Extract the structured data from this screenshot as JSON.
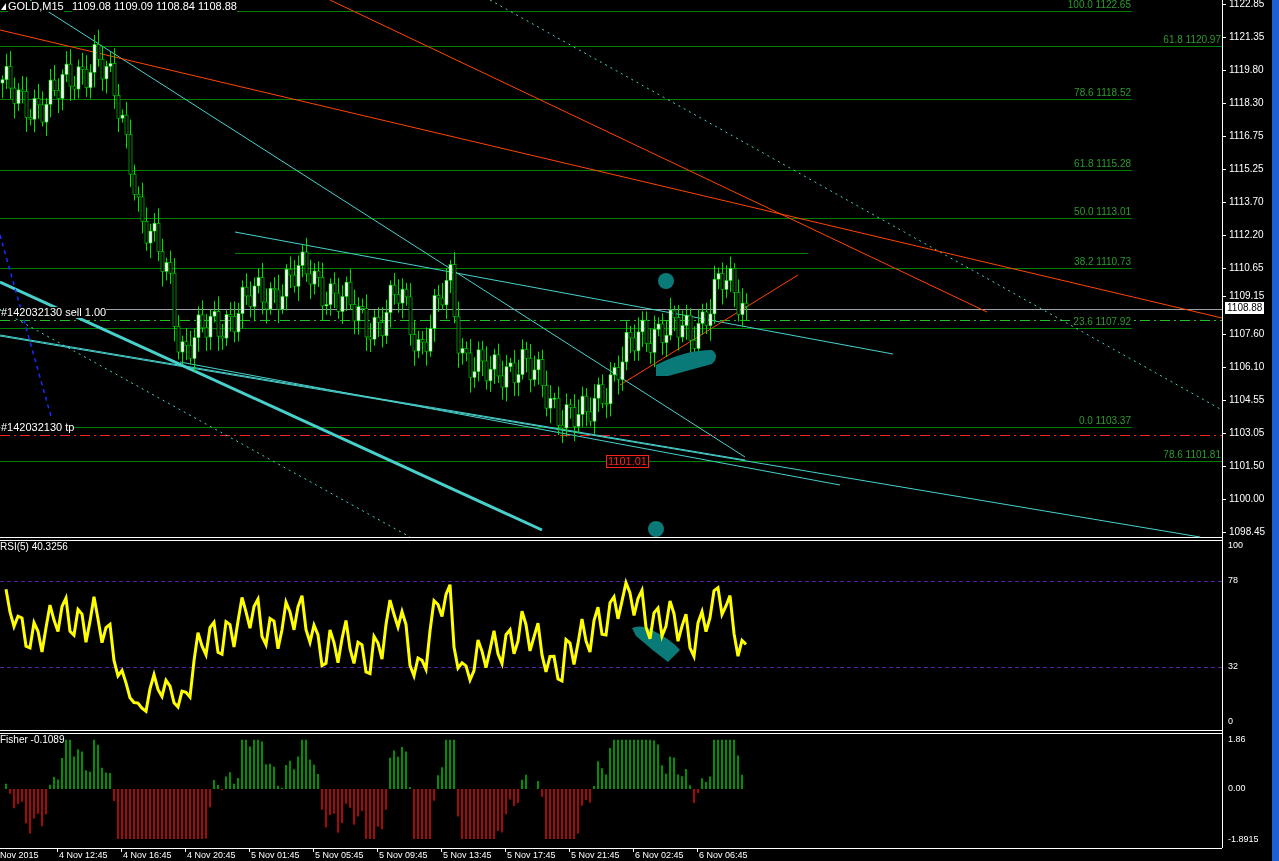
{
  "symbol": {
    "title": "GOLD,M15",
    "ohlc": "1109.08 1109.09 1108.84 1108.88"
  },
  "price_axis": {
    "labels": [
      "1122.85",
      "1121.35",
      "1119.80",
      "1118.30",
      "1116.75",
      "1115.25",
      "1113.70",
      "1112.20",
      "1110.65",
      "1109.15",
      "1107.60",
      "1106.10",
      "1104.55",
      "1103.05",
      "1101.50",
      "1100.00",
      "1098.45"
    ],
    "current_price": "1108.88"
  },
  "fib_levels": [
    {
      "label": "100.0 1122.65"
    },
    {
      "label": "61.8 1120.97"
    },
    {
      "label": "78.6 1118.52"
    },
    {
      "label": "61.8 1115.28"
    },
    {
      "label": "50.0  1113.01"
    },
    {
      "label": "38.2 1110.73"
    },
    {
      "label": "23.6 1107.92"
    },
    {
      "label": "0.0 1103.37"
    },
    {
      "label": "78.6 1101.81"
    }
  ],
  "orders": [
    {
      "label": "#142032130 sell 1.00",
      "kind": "entry"
    },
    {
      "label": "#142032130 tp",
      "kind": "tp"
    }
  ],
  "price_tag": "1101.01",
  "rsi": {
    "label": "RSI(5) 40.3256",
    "axis": [
      "100",
      "78",
      "32",
      "0"
    ]
  },
  "fisher": {
    "label": "Fisher -0.1089",
    "axis": [
      "1.86",
      "0.00",
      "-1.8915"
    ]
  },
  "time_axis": [
    "Nov 2015",
    "4 Nov 12:45",
    "4 Nov 16:45",
    "4 Nov 20:45",
    "5 Nov 01:45",
    "5 Nov 05:45",
    "5 Nov 09:45",
    "5 Nov 13:45",
    "5 Nov 17:45",
    "5 Nov 21:45",
    "6 Nov 02:45",
    "6 Nov 06:45"
  ]
}
